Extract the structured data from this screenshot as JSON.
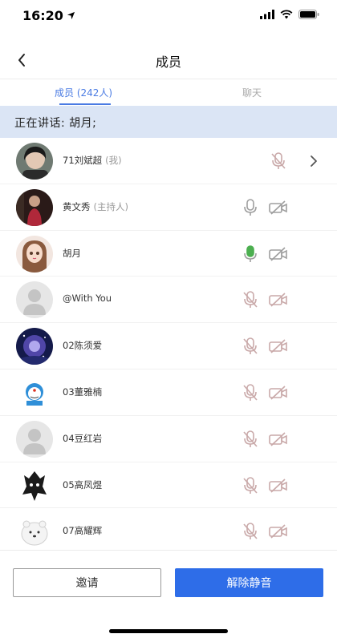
{
  "status_bar": {
    "time": "16:20"
  },
  "header": {
    "title": "成员"
  },
  "tabs": [
    {
      "label": "成员 (242人)",
      "active": true
    },
    {
      "label": "聊天",
      "active": false
    }
  ],
  "speaking": {
    "text": "正在讲话: 胡月;"
  },
  "members": [
    {
      "name": "71刘斌超",
      "tag": "(我)",
      "avatar": "dark-hair-portrait",
      "mic": "muted",
      "camera": "hidden",
      "chevron": true
    },
    {
      "name": "黄文秀",
      "tag": "(主持人)",
      "avatar": "red-dress-photo",
      "mic": "on",
      "camera": "off",
      "chevron": false
    },
    {
      "name": "胡月",
      "tag": "",
      "avatar": "anime-girl",
      "mic": "active",
      "camera": "off",
      "chevron": false
    },
    {
      "name": "@With You",
      "tag": "",
      "avatar": "default-person",
      "mic": "muted",
      "camera": "off",
      "chevron": false
    },
    {
      "name": "02陈须爱",
      "tag": "",
      "avatar": "galaxy-scene",
      "mic": "muted",
      "camera": "off",
      "chevron": false
    },
    {
      "name": "03董雅楠",
      "tag": "",
      "avatar": "doraemon-sticker",
      "mic": "muted",
      "camera": "off",
      "chevron": false
    },
    {
      "name": "04豆红岩",
      "tag": "",
      "avatar": "default-person",
      "mic": "muted",
      "camera": "off",
      "chevron": false
    },
    {
      "name": "05高凤煜",
      "tag": "",
      "avatar": "dark-sketch",
      "mic": "muted",
      "camera": "off",
      "chevron": false
    },
    {
      "name": "07高耀辉",
      "tag": "",
      "avatar": "white-bear-sticker",
      "mic": "muted",
      "camera": "off",
      "chevron": false
    }
  ],
  "footer": {
    "invite_label": "邀请",
    "unmute_label": "解除静音"
  },
  "colors": {
    "accent": "#2e6de8",
    "tab_active": "#4a7be3",
    "banner_bg": "#dbe5f5",
    "mic_active": "#4caf50",
    "icon_muted": "#c9a9a9",
    "icon_gray": "#9e9e9e"
  }
}
